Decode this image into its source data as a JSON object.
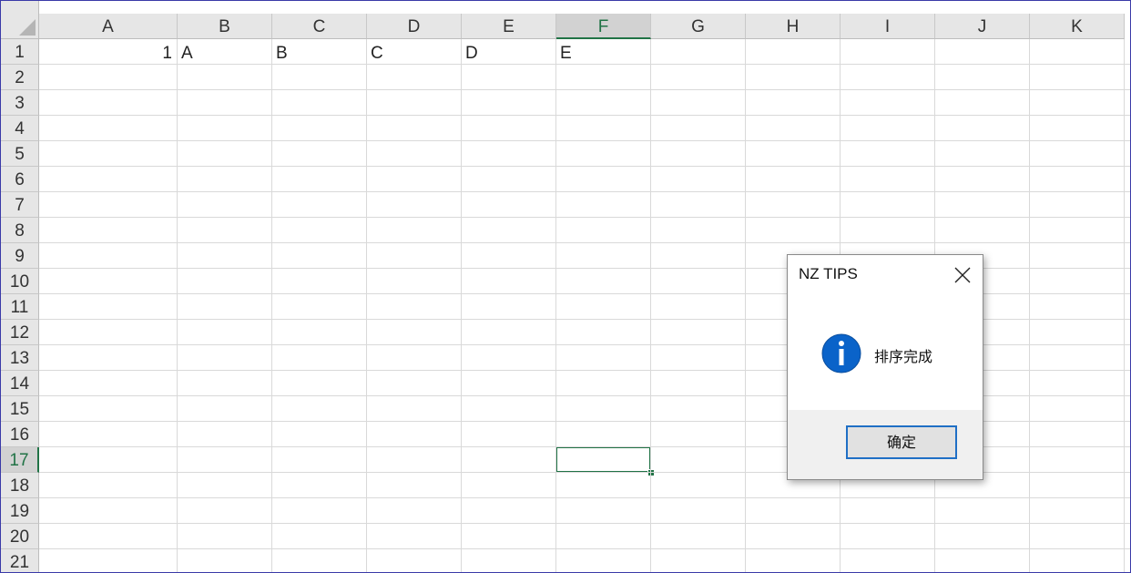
{
  "sheet": {
    "columns": [
      "A",
      "B",
      "C",
      "D",
      "E",
      "F",
      "G",
      "H",
      "I",
      "J",
      "K"
    ],
    "rows": [
      "1",
      "2",
      "3",
      "4",
      "5",
      "6",
      "7",
      "8",
      "9",
      "10",
      "11",
      "12",
      "13",
      "14",
      "15",
      "16",
      "17",
      "18",
      "19",
      "20",
      "21"
    ],
    "active_column": "F",
    "active_row": "17",
    "cells": {
      "A1": "1",
      "B1": "A",
      "C1": "B",
      "D1": "C",
      "E1": "D",
      "F1": "E"
    }
  },
  "dialog": {
    "title": "NZ TIPS",
    "message": "排序完成",
    "ok_label": "确定",
    "icon": "info-icon",
    "icon_color": "#0a63c9"
  },
  "colors": {
    "accent": "#217346",
    "grid": "#d9d9d9",
    "header_bg": "#e6e6e6"
  }
}
